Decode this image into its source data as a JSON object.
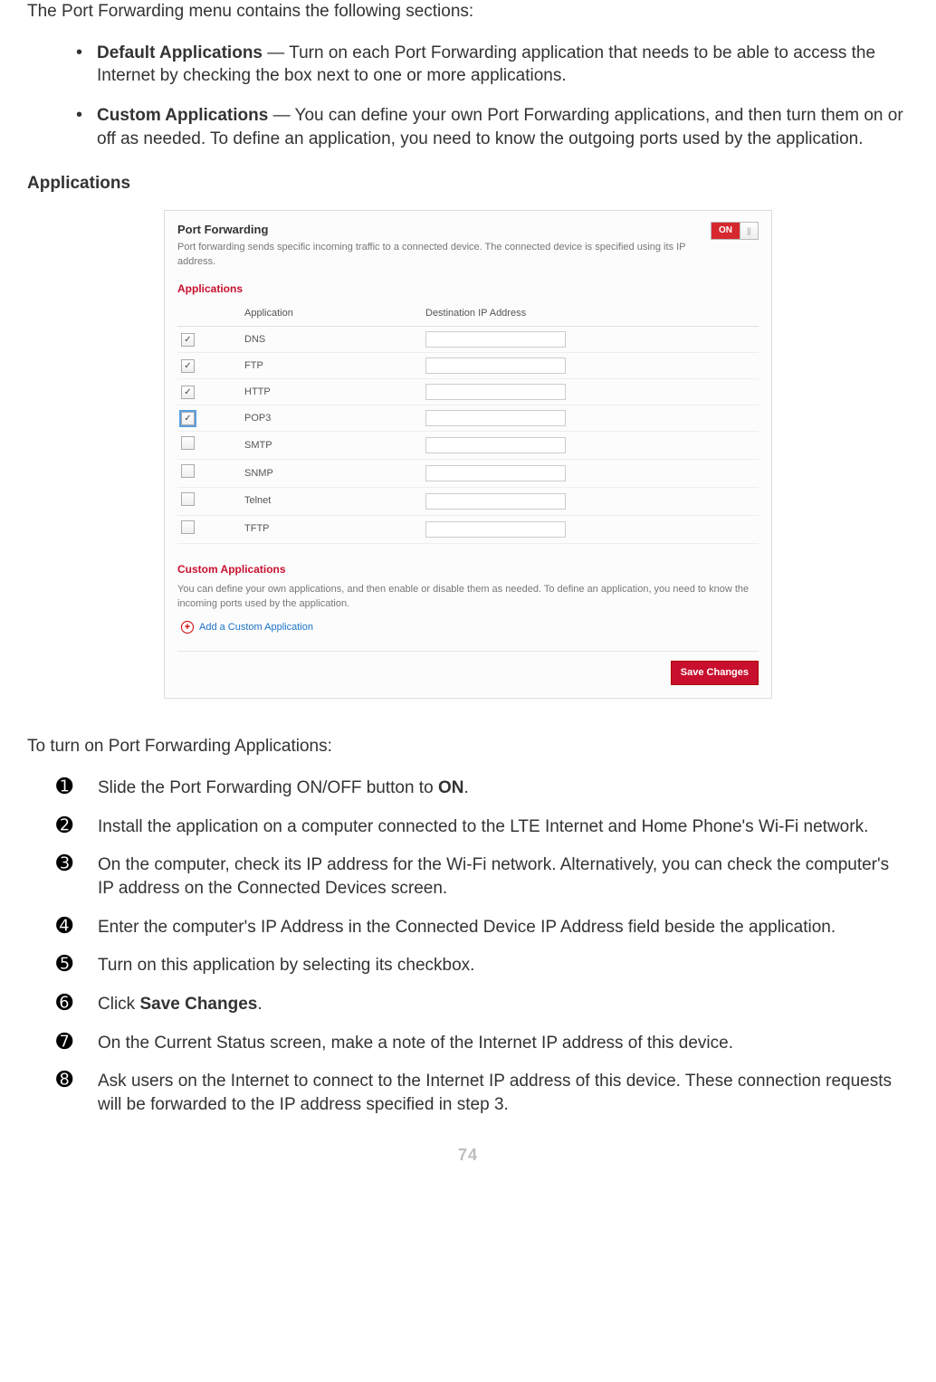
{
  "intro": "The Port Forwarding menu contains the following sections:",
  "bullets": [
    {
      "bold": "Default Applications",
      "rest": " — Turn on each Port Forwarding application that needs to be able to access the Internet by checking the box next to one or more applications."
    },
    {
      "bold": "Custom Applications",
      "rest": " — You can define your own Port Forwarding applications, and then turn them on or off as needed. To define an application, you need to know the outgoing ports used by the application."
    }
  ],
  "sectionHeader": "Applications",
  "panel": {
    "title": "Port Forwarding",
    "desc": "Port forwarding sends specific incoming traffic to a connected device. The connected device is specified using its IP address.",
    "toggle": "ON",
    "appsTitle": "Applications",
    "th1": "Application",
    "th2": "Destination IP Address",
    "rows": [
      {
        "checked": true,
        "focus": false,
        "name": "DNS"
      },
      {
        "checked": true,
        "focus": false,
        "name": "FTP"
      },
      {
        "checked": true,
        "focus": false,
        "name": "HTTP"
      },
      {
        "checked": true,
        "focus": true,
        "name": "POP3"
      },
      {
        "checked": false,
        "focus": false,
        "name": "SMTP"
      },
      {
        "checked": false,
        "focus": false,
        "name": "SNMP"
      },
      {
        "checked": false,
        "focus": false,
        "name": "Telnet"
      },
      {
        "checked": false,
        "focus": false,
        "name": "TFTP"
      }
    ],
    "customTitle": "Custom Applications",
    "customDesc": "You can define your own applications, and then enable or disable them as needed. To define an application, you need to know the incoming ports used by the application.",
    "addLink": "Add a Custom Application",
    "saveBtn": "Save Changes"
  },
  "instrLead": "To turn on Port Forwarding Applications:",
  "steps": [
    {
      "num": "➊",
      "pre": "Slide the Port Forwarding ON/OFF button to ",
      "bold": "ON",
      "post": "."
    },
    {
      "num": "➋",
      "pre": "Install the application on a computer connected to the LTE Internet and Home Phone's Wi-Fi network.",
      "bold": "",
      "post": ""
    },
    {
      "num": "➌",
      "pre": "On the computer, check its IP address for the Wi-Fi network. Alternatively, you can check the computer's IP address on the Connected Devices screen.",
      "bold": "",
      "post": ""
    },
    {
      "num": "➍",
      "pre": "Enter the computer's IP Address in the Connected Device IP Address field beside the application.",
      "bold": "",
      "post": ""
    },
    {
      "num": "➎",
      "pre": "Turn on this application by selecting its checkbox.",
      "bold": "",
      "post": ""
    },
    {
      "num": "➏",
      "pre": "Click ",
      "bold": "Save Changes",
      "post": "."
    },
    {
      "num": "➐",
      "pre": "On the Current Status screen, make a note of the Internet IP address of this device.",
      "bold": "",
      "post": ""
    },
    {
      "num": "➑",
      "pre": "Ask users on the Internet to connect to the Internet IP address of this device. These connection requests will be forwarded to the IP address specified in step 3.",
      "bold": "",
      "post": ""
    }
  ],
  "pageNum": "74"
}
